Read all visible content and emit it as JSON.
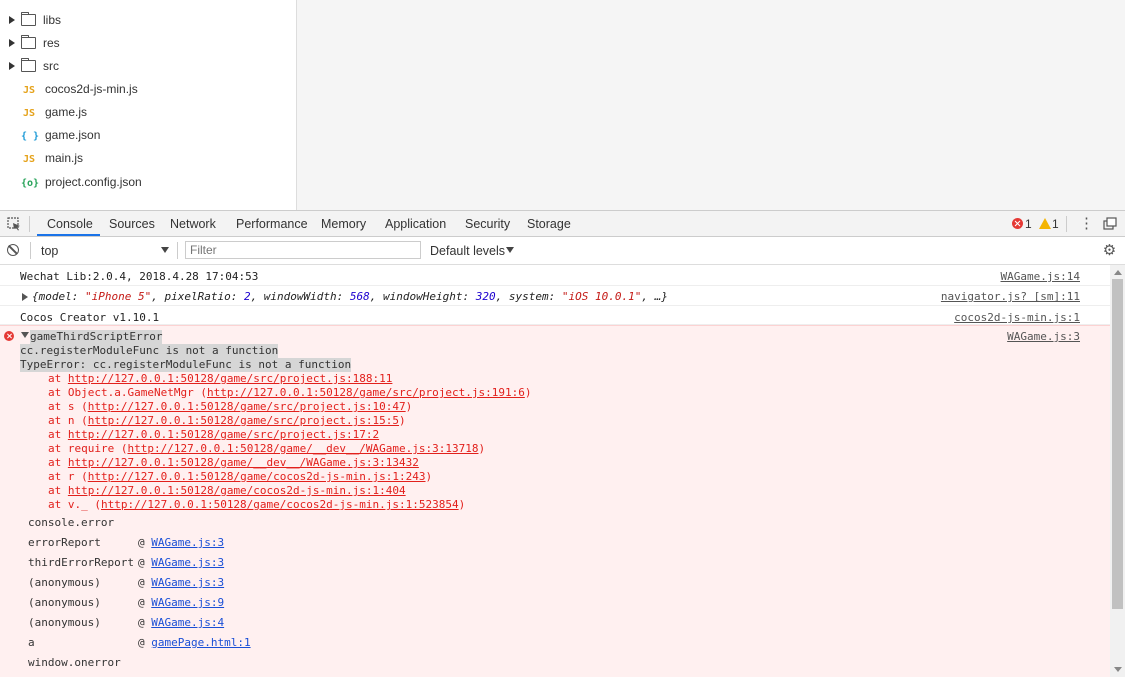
{
  "file_tree": {
    "items": [
      {
        "type": "folder",
        "label": "libs"
      },
      {
        "type": "folder",
        "label": "res"
      },
      {
        "type": "folder",
        "label": "src"
      },
      {
        "type": "js",
        "icon": "JS",
        "label": "cocos2d-js-min.js"
      },
      {
        "type": "js",
        "icon": "JS",
        "label": "game.js"
      },
      {
        "type": "json",
        "icon": "{ }",
        "label": "game.json"
      },
      {
        "type": "js",
        "icon": "JS",
        "label": "main.js"
      },
      {
        "type": "config",
        "icon": "{o}",
        "label": "project.config.json"
      }
    ]
  },
  "devtools": {
    "tabs": [
      "Console",
      "Sources",
      "Network",
      "Performance",
      "Memory",
      "Application",
      "Security",
      "Storage"
    ],
    "active_tab": "Console",
    "error_count": "1",
    "warning_count": "1",
    "more_icon": "⋮",
    "accent_color": "#1a73e8"
  },
  "filter_bar": {
    "context": "top",
    "filter_placeholder": "Filter",
    "levels": "Default levels"
  },
  "console": {
    "line1": {
      "text": "Wechat Lib:2.0.4, 2018.4.28 17:04:53",
      "source": "WAGame.js:14"
    },
    "line2": {
      "text_prefix": "{",
      "k1": "model: ",
      "v1": "\"iPhone 5\"",
      "k2": ", pixelRatio: ",
      "v2": "2",
      "k3": ", windowWidth: ",
      "v3": "568",
      "k4": ", windowHeight: ",
      "v4": "320",
      "k5": ", system: ",
      "v5": "\"iOS 10.0.1\"",
      "tail": ", …}",
      "source": "navigator.js? [sm]:11"
    },
    "line3": {
      "text": "Cocos Creator v1.10.1",
      "source": "cocos2d-js-min.js:1"
    },
    "error": {
      "title": "gameThirdScriptError",
      "message": "cc.registerModuleFunc is not a function",
      "type_line": "TypeError: cc.registerModuleFunc is not a function",
      "source": "WAGame.js:3",
      "stack": [
        {
          "prefix": "at ",
          "link": "http://127.0.0.1:50128/game/src/project.js:188:11",
          "suffix": ""
        },
        {
          "prefix": "at Object.a.GameNetMgr (",
          "link": "http://127.0.0.1:50128/game/src/project.js:191:6",
          "suffix": ")"
        },
        {
          "prefix": "at s (",
          "link": "http://127.0.0.1:50128/game/src/project.js:10:47",
          "suffix": ")"
        },
        {
          "prefix": "at n (",
          "link": "http://127.0.0.1:50128/game/src/project.js:15:5",
          "suffix": ")"
        },
        {
          "prefix": "at ",
          "link": "http://127.0.0.1:50128/game/src/project.js:17:2",
          "suffix": ""
        },
        {
          "prefix": "at require (",
          "link": "http://127.0.0.1:50128/game/__dev__/WAGame.js:3:13718",
          "suffix": ")"
        },
        {
          "prefix": "at ",
          "link": "http://127.0.0.1:50128/game/__dev__/WAGame.js:3:13432",
          "suffix": ""
        },
        {
          "prefix": "at r (",
          "link": "http://127.0.0.1:50128/game/cocos2d-js-min.js:1:243",
          "suffix": ")"
        },
        {
          "prefix": "at ",
          "link": "http://127.0.0.1:50128/game/cocos2d-js-min.js:1:404",
          "suffix": ""
        },
        {
          "prefix": "at v._ (",
          "link": "http://127.0.0.1:50128/game/cocos2d-js-min.js:1:523854",
          "suffix": ")"
        }
      ],
      "trace": [
        {
          "name": "console.error",
          "at": "",
          "link": ""
        },
        {
          "name": "errorReport",
          "at": "@ ",
          "link": "WAGame.js:3"
        },
        {
          "name": "thirdErrorReport",
          "at": "@ ",
          "link": "WAGame.js:3"
        },
        {
          "name": "(anonymous)",
          "at": "@ ",
          "link": "WAGame.js:3"
        },
        {
          "name": "(anonymous)",
          "at": "@ ",
          "link": "WAGame.js:9"
        },
        {
          "name": "(anonymous)",
          "at": "@ ",
          "link": "WAGame.js:4"
        },
        {
          "name": "a",
          "at": "@ ",
          "link": "gamePage.html:1"
        },
        {
          "name": "window.onerror",
          "at": "",
          "link": ""
        }
      ]
    }
  }
}
